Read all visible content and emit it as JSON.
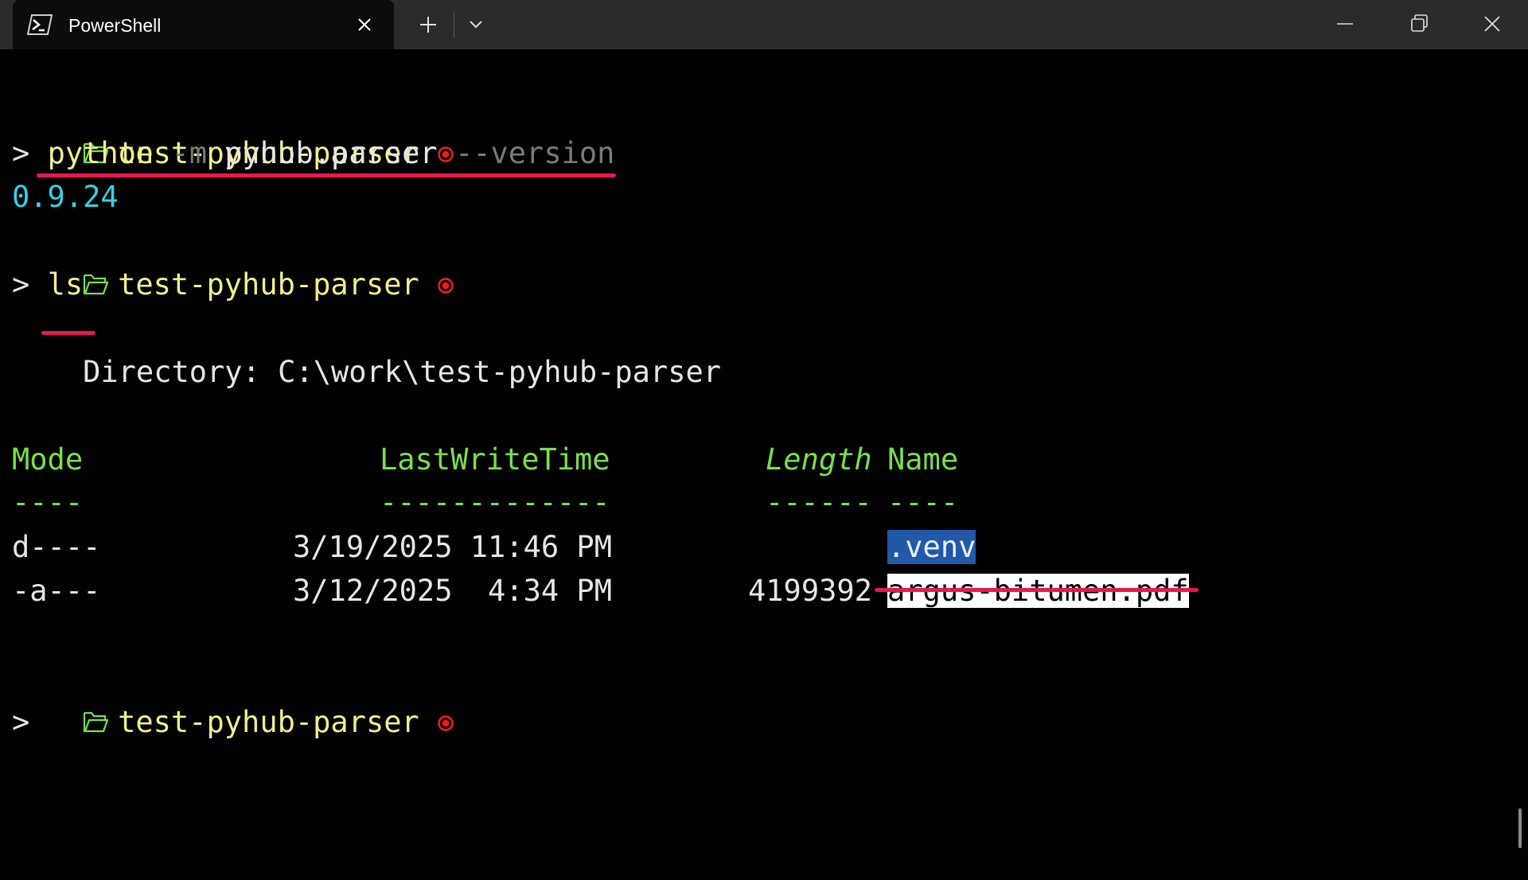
{
  "window": {
    "tab_title": "PowerShell",
    "tab_icon": "powershell-icon",
    "new_tab_icon": "plus-icon",
    "dropdown_icon": "chevron-down-icon",
    "controls": [
      "minimize-icon",
      "restore-icon",
      "close-icon"
    ]
  },
  "colors": {
    "prompt_dir": "#f0ef8a",
    "folder_icon": "#79e04a",
    "record_dot": "#ff1a1a",
    "version_output": "#2fd3e6",
    "table_header": "#79e04a",
    "annotation_underline": "#e8194e",
    "selection_blue": "#2158a8"
  },
  "terminal": {
    "prompt_dir": "test-pyhub-parser",
    "prompt_symbol": ">",
    "cmd1": {
      "program": "python",
      "flag": "-m",
      "module": "pyhub.parser",
      "option": "--version"
    },
    "version_output": "0.9.24",
    "cmd2": "ls",
    "directory_line": "    Directory: C:\\work\\test-pyhub-parser",
    "table": {
      "headers": {
        "mode": "Mode",
        "lastwritetime": "LastWriteTime",
        "length": "Length",
        "name": "Name"
      },
      "separators": {
        "mode": "----",
        "lastwritetime": "-------------",
        "length": "------",
        "name": "----"
      },
      "rows": [
        {
          "mode": "d----",
          "lastwritetime": "3/19/2025 11:46 PM",
          "length": "",
          "name": ".venv"
        },
        {
          "mode": "-a---",
          "lastwritetime": "3/12/2025  4:34 PM",
          "length": "4199392",
          "name": "argus-bitumen.pdf"
        }
      ]
    }
  }
}
